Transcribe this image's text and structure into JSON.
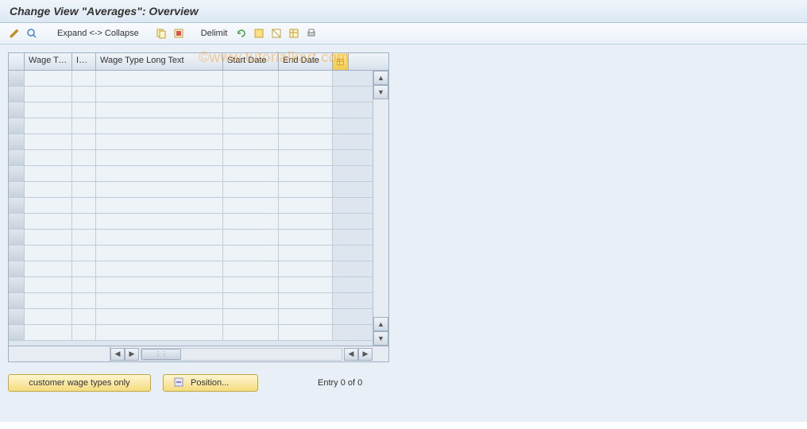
{
  "title": "Change View \"Averages\": Overview",
  "watermark": "©www.tutorialkart.com",
  "toolbar": {
    "expand_label": "Expand <-> Collapse",
    "delimit_label": "Delimit"
  },
  "table": {
    "columns": {
      "wage_type": "Wage Ty...",
      "inf": "Inf...",
      "long_text": "Wage Type Long Text",
      "start_date": "Start Date",
      "end_date": "End Date"
    }
  },
  "footer": {
    "customer_btn": "customer wage types only",
    "position_btn": "Position...",
    "entry_text": "Entry 0 of 0"
  }
}
